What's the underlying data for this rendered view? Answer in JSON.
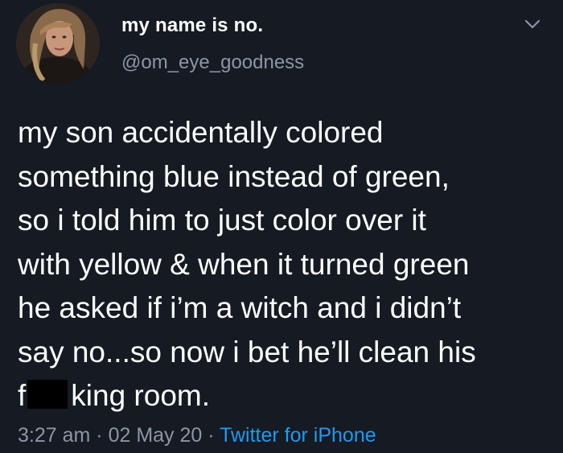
{
  "user": {
    "display_name": "my name is no.",
    "handle": "@om_eye_goodness"
  },
  "tweet": {
    "lines": [
      "my son accidentally colored",
      "something blue instead of green,",
      "so i told him to just color over it",
      "with yellow & when it turned green",
      "he asked if i’m a witch and i didn’t",
      "say no...so now i bet he’ll clean his"
    ],
    "last_line_prefix": "f",
    "last_line_suffix": "king room."
  },
  "meta": {
    "time": "3:27 am",
    "date": "02 May 20",
    "separator": "·",
    "source": "Twitter for iPhone"
  },
  "colors": {
    "background": "#151a23",
    "text": "#ffffff",
    "secondary_text": "#8b97a5",
    "link": "#1d9bf0"
  },
  "icons": {
    "menu": "chevron-down-icon",
    "avatar": "profile-photo"
  }
}
